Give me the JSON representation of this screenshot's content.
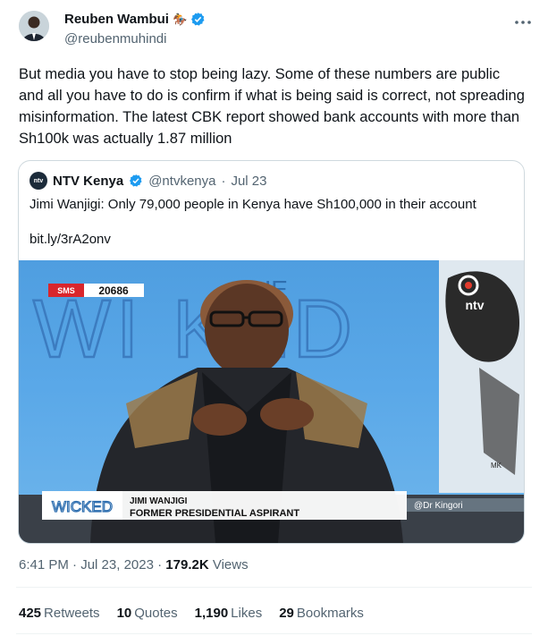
{
  "author": {
    "name": "Reuben Wambui",
    "handle": "@reubenmuhindi",
    "badge_emoji": "🏇",
    "verified": true
  },
  "tweet_text": "But media you have to stop being lazy. Some of these numbers are public and all you have to do is confirm if what is being said is correct, not spreading misinformation. The latest CBK report showed bank accounts with more than Sh100k was actually 1.87 million",
  "quote": {
    "name": "NTV Kenya",
    "avatar_text": "ntv",
    "handle": "@ntvkenya",
    "separator": "·",
    "date": "Jul 23",
    "text": "Jimi Wanjigi: Only 79,000 people in Kenya have Sh100,000 in their account",
    "link": "bit.ly/3rA2onv",
    "media": {
      "sms_label": "SMS",
      "sms_number": "20686",
      "background_title": "THE WICKED",
      "channel_logo": "ntv",
      "small_logo": "WICKED",
      "guest_name": "JIMI WANJIGI",
      "guest_title": "FORMER PRESIDENTIAL ASPIRANT",
      "artist_credit": "@Dr Kingori"
    }
  },
  "meta": {
    "time": "6:41 PM",
    "separator": "·",
    "date": "Jul 23, 2023",
    "views_count": "179.2K",
    "views_label": "Views"
  },
  "stats": [
    {
      "count": "425",
      "label": "Retweets"
    },
    {
      "count": "10",
      "label": "Quotes"
    },
    {
      "count": "1,190",
      "label": "Likes"
    },
    {
      "count": "29",
      "label": "Bookmarks"
    }
  ],
  "colors": {
    "verified_blue": "#1d9bf0",
    "secondary_text": "#536471",
    "studio_blue": "#5aa8e8",
    "sms_red": "#d9262c"
  },
  "icons": [
    "verified-badge-icon",
    "more-options-icon"
  ]
}
